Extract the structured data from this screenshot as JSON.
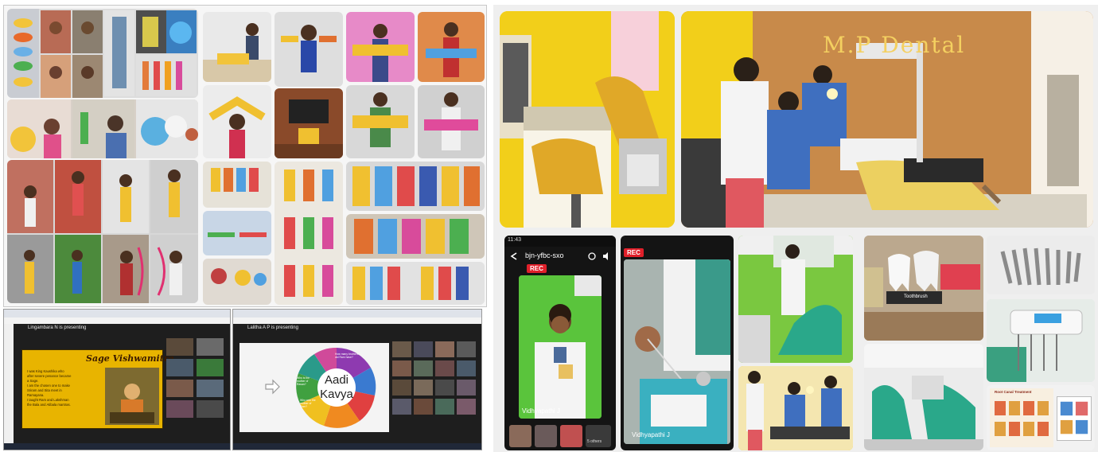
{
  "colors": {
    "background": "#ffffff",
    "collage_border": "#c8c8c8",
    "wall_yellow": "#f2cf1a",
    "wood_wall": "#c88a4a",
    "dental_green": "#3fa892",
    "rec_red": "#e0202a",
    "slide_yellow": "#e8b400",
    "call_dark": "#1a1a1a"
  },
  "top_left_collage": {
    "description_icons": [
      "puppet-icon",
      "child-icon",
      "bow-icon",
      "cutout-icon"
    ]
  },
  "video_call_1": {
    "presenter_banner": "Lingambara N is presenting",
    "slide_title": "Sage Vishwamitra",
    "slide_bullets": [
      "I was King Kaushika who",
      "after severe penance became",
      "a Sage.",
      "I am the chosen one to make",
      "Sriram and Sita meet in",
      "Ramayana.",
      "I taught Ram and Lakshman",
      "the Bala and Atibala mantras."
    ]
  },
  "video_call_2": {
    "presenter_banner": "Lalitha A P is presenting",
    "slide_title_line1": "Aadi",
    "slide_title_line2": "Kavya",
    "wheel_labels": [
      "How many brothers did Ram have?",
      "Who is the mother of Ravan?",
      "Who was the mother of Ram?"
    ]
  },
  "top_right_photo": {
    "sign_text": "M.P Dental"
  },
  "phone_call_1": {
    "status_time": "11:43",
    "meeting_code": "bjn-yfbc-sxo",
    "rec_label": "REC",
    "participant_name": "Vidhyapathi J",
    "others_label": "5 others"
  },
  "phone_call_2": {
    "rec_label": "REC",
    "participant_name": "Vidhyapathi J"
  },
  "dental_photos": {
    "toothbrush_label": "Toothbrush",
    "poster_title": "Root Canal Treatment"
  }
}
